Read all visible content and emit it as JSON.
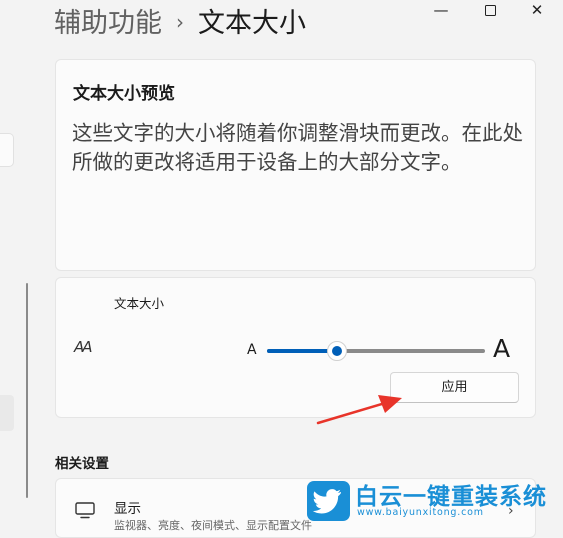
{
  "header": {
    "breadcrumb_parent": "辅助功能",
    "breadcrumb_separator": "›",
    "breadcrumb_current": "文本大小"
  },
  "window_controls": {
    "minimize_glyph": "—",
    "close_glyph": "✕"
  },
  "preview": {
    "title": "文本大小预览",
    "text": "这些文字的大小将随着你调整滑块而更改。在此处所做的更改将适用于设备上的大部分文字。"
  },
  "text_size": {
    "label": "文本大小",
    "icon": "text-size-icon",
    "icon_glyph": "AA",
    "min_label": "A",
    "max_label": "A",
    "slider_fraction": 0.32,
    "apply_label": "应用"
  },
  "related": {
    "heading": "相关设置",
    "display": {
      "title": "显示",
      "subtitle": "监视器、亮度、夜间模式、显示配置文件",
      "icon": "monitor-icon"
    }
  },
  "watermark": {
    "text": "白云一键重装系统",
    "url": "www.baiyunxitong.com"
  },
  "colors": {
    "accent": "#005fb8",
    "annotation_arrow": "#e8342a",
    "watermark": "#1a8fd6"
  }
}
